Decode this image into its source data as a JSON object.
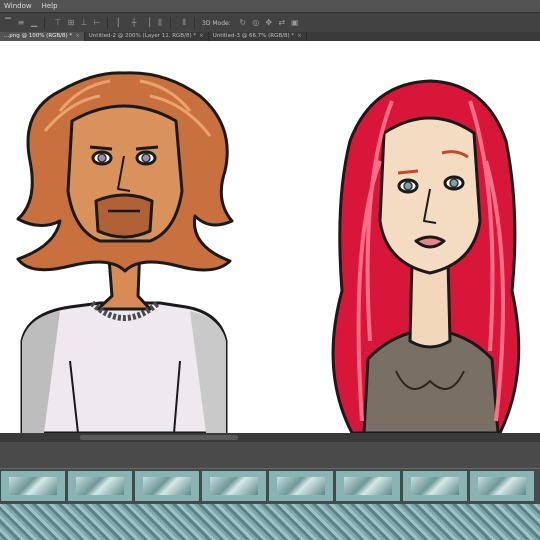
{
  "menu": {
    "items": [
      "Window",
      "Help"
    ]
  },
  "options_bar": {
    "mode_label": "3D Mode:"
  },
  "tabs": [
    {
      "label": "...png @ 100% (RGB/8) *",
      "close": "×"
    },
    {
      "label": "Untitled-2 @ 200% (Layer 11, RGB/8) *",
      "close": "×"
    },
    {
      "label": "Untitled-3 @ 66.7% (RGB/8) *",
      "close": "×"
    }
  ],
  "colors": {
    "canvas_bg": "#ffffff",
    "panel_bg": "#4a4a4a",
    "tile_teal": "#8ab3b3"
  }
}
